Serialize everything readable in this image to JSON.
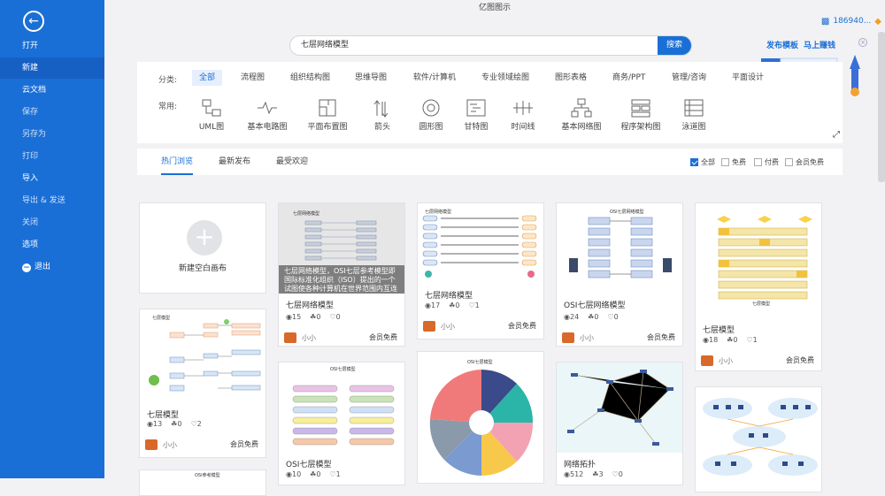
{
  "app": {
    "title": "亿图图示"
  },
  "user": {
    "id": "186940..."
  },
  "sidebar": {
    "items": [
      {
        "label": "打开"
      },
      {
        "label": "新建"
      },
      {
        "label": "云文档"
      },
      {
        "label": "保存"
      },
      {
        "label": "另存为"
      },
      {
        "label": "打印"
      },
      {
        "label": "导入"
      },
      {
        "label": "导出 & 发送"
      },
      {
        "label": "关闭"
      },
      {
        "label": "选项"
      },
      {
        "label": "退出"
      }
    ]
  },
  "search": {
    "value": "七层网络模型",
    "button": "搜索"
  },
  "promo": {
    "t1": "发布模板",
    "t2": "马上赚钱"
  },
  "categories": {
    "label": "分类:",
    "items": [
      "全部",
      "流程图",
      "组织结构图",
      "思维导图",
      "软件/计算机",
      "专业领域绘图",
      "图形表格",
      "商务/PPT",
      "管理/咨询",
      "平面设计"
    ]
  },
  "common": {
    "label": "常用:",
    "items": [
      "UML图",
      "基本电路图",
      "平面布置图",
      "箭头",
      "圆形图",
      "甘特图",
      "时间线",
      "基本网络图",
      "程序架构图",
      "泳道图"
    ]
  },
  "tabs": [
    "热门浏览",
    "最新发布",
    "最受欢迎"
  ],
  "filters": [
    "全部",
    "免费",
    "付费",
    "会员免费"
  ],
  "blank": {
    "label": "新建空白画布"
  },
  "cards": [
    {
      "thumb_title": "七层网络模型",
      "title": "七层网络模型",
      "views": "15",
      "likes": "0",
      "favs": "0",
      "author": "小小",
      "price": "会员免费",
      "overlay": "七层网络模型，OSI七层参考模型即国际标准化组织（ISO）提出的一个试图使各种计算机在世界范围内互连为网络的标准框架"
    },
    {
      "thumb_title": "七层网络模型",
      "title": "七层网络模型",
      "views": "17",
      "likes": "0",
      "favs": "1",
      "author": "小小",
      "price": "会员免费"
    },
    {
      "thumb_title": "OSI七层网络模型",
      "title": "OSI七层网络模型",
      "views": "24",
      "likes": "0",
      "favs": "0",
      "author": "小小",
      "price": "会员免费"
    },
    {
      "thumb_title": "七层模型",
      "title": "七层模型",
      "views": "18",
      "likes": "0",
      "favs": "1",
      "author": "小小",
      "price": "会员免费"
    },
    {
      "thumb_title": "七层模型",
      "title": "七层模型",
      "views": "13",
      "likes": "0",
      "favs": "2",
      "author": "小小",
      "price": "会员免费"
    },
    {
      "thumb_title": "OSI七层模型",
      "title": "OSI七层模型",
      "views": "10",
      "likes": "0",
      "favs": "1"
    },
    {
      "thumb_title": "OSI七层模型"
    },
    {
      "title": "网络拓扑",
      "views": "512",
      "likes": "3",
      "favs": "0"
    },
    {},
    {
      "thumb_title": "OSI参考模型"
    }
  ]
}
